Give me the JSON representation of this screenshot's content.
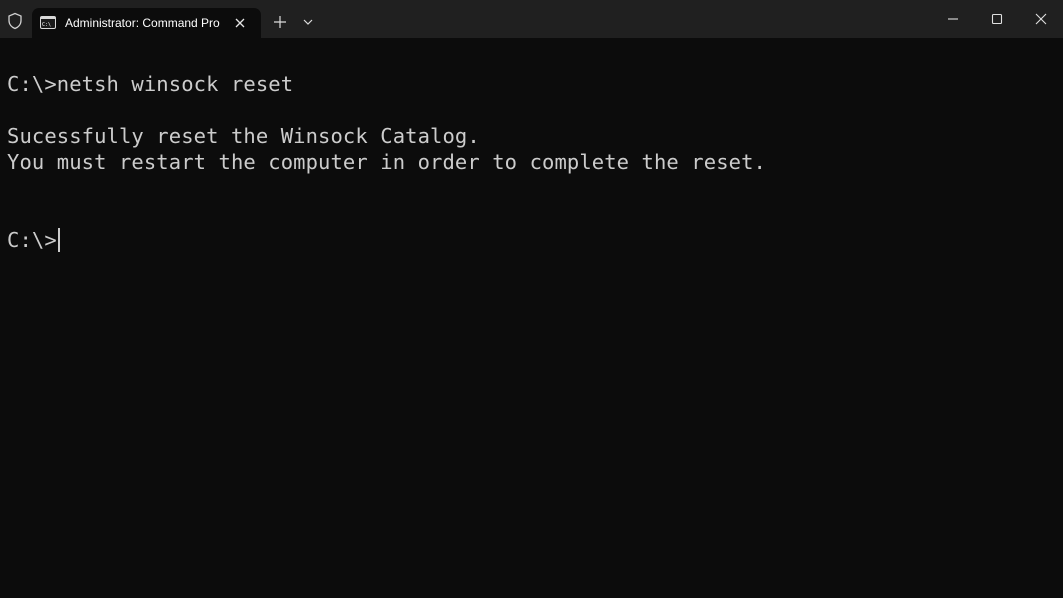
{
  "window": {
    "tab_title": "Administrator: Command Pro",
    "icons": {
      "shield": "shield-icon",
      "tab": "command-prompt-icon",
      "close_tab": "close-icon",
      "new_tab": "plus-icon",
      "dropdown": "chevron-down-icon",
      "minimize": "minimize-icon",
      "maximize": "maximize-icon",
      "close_window": "close-icon"
    }
  },
  "terminal": {
    "lines": [
      "C:\\>netsh winsock reset",
      "Sucessfully reset the Winsock Catalog.",
      "You must restart the computer in order to complete the reset.",
      "C:\\>"
    ]
  },
  "colors": {
    "titlebar_bg": "#202020",
    "terminal_bg": "#0c0c0c",
    "text": "#cccccc"
  }
}
